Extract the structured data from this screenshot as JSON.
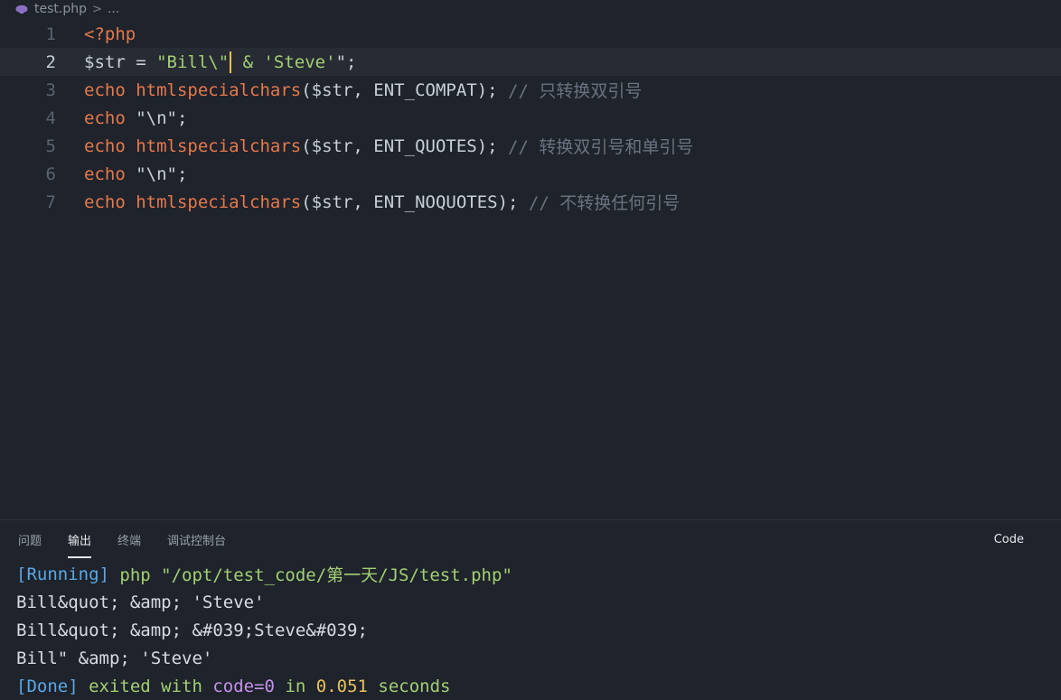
{
  "breadcrumb": {
    "file": "test.php",
    "separator": ">",
    "ellipsis": "..."
  },
  "editor": {
    "lines": [
      {
        "num": "1",
        "tokens": [
          {
            "t": "<?php",
            "c": "kw"
          }
        ]
      },
      {
        "num": "2",
        "active": true,
        "tokens": [
          {
            "t": "$str",
            "c": "var"
          },
          {
            "t": " = ",
            "c": "pun"
          },
          {
            "t": "\"Bill\\\"",
            "c": "str"
          },
          {
            "cursor": true
          },
          {
            "t": " & 'Steve'",
            "c": "str"
          },
          {
            "t": "\";",
            "c": "pun"
          }
        ]
      },
      {
        "num": "3",
        "tokens": [
          {
            "t": "echo ",
            "c": "kw"
          },
          {
            "t": "htmlspecialchars",
            "c": "fn"
          },
          {
            "t": "($str, ENT_COMPAT); ",
            "c": "pun"
          },
          {
            "t": "// 只转换双引号",
            "c": "cmt"
          }
        ]
      },
      {
        "num": "4",
        "tokens": [
          {
            "t": "echo ",
            "c": "kw"
          },
          {
            "t": "\"\\n\"",
            "c": "pun"
          },
          {
            "t": ";",
            "c": "pun"
          }
        ]
      },
      {
        "num": "5",
        "tokens": [
          {
            "t": "echo ",
            "c": "kw"
          },
          {
            "t": "htmlspecialchars",
            "c": "fn"
          },
          {
            "t": "($str, ENT_QUOTES); ",
            "c": "pun"
          },
          {
            "t": "// 转换双引号和单引号",
            "c": "cmt"
          }
        ]
      },
      {
        "num": "6",
        "tokens": [
          {
            "t": "echo ",
            "c": "kw"
          },
          {
            "t": "\"\\n\"",
            "c": "pun"
          },
          {
            "t": ";",
            "c": "pun"
          }
        ]
      },
      {
        "num": "7",
        "tokens": [
          {
            "t": "echo ",
            "c": "kw"
          },
          {
            "t": "htmlspecialchars",
            "c": "fn"
          },
          {
            "t": "($str, ENT_NOQUOTES); ",
            "c": "pun"
          },
          {
            "t": "// 不转换任何引号",
            "c": "cmt"
          }
        ]
      }
    ]
  },
  "panel": {
    "tabs": [
      "问题",
      "输出",
      "终端",
      "调试控制台"
    ],
    "active_tab": "输出",
    "channel": "Code",
    "output": {
      "running_tag": "[Running]",
      "running_cmd": " php \"/opt/test_code/第一天/JS/test.php\"",
      "line1": "Bill&quot; &amp; 'Steve'",
      "line2": "Bill&quot; &amp; &#039;Steve&#039;",
      "line3": "Bill\" &amp; 'Steve'",
      "done_tag": "[Done]",
      "done_exited": " exited with ",
      "done_code": "code=0",
      "done_in": " in ",
      "done_time": "0.051",
      "done_seconds": " seconds"
    }
  },
  "colors": {
    "background": "#1f232b",
    "keyword": "#e5794c",
    "string": "#a3cf74",
    "comment": "#6b7280",
    "cursor": "#f0c24f"
  }
}
